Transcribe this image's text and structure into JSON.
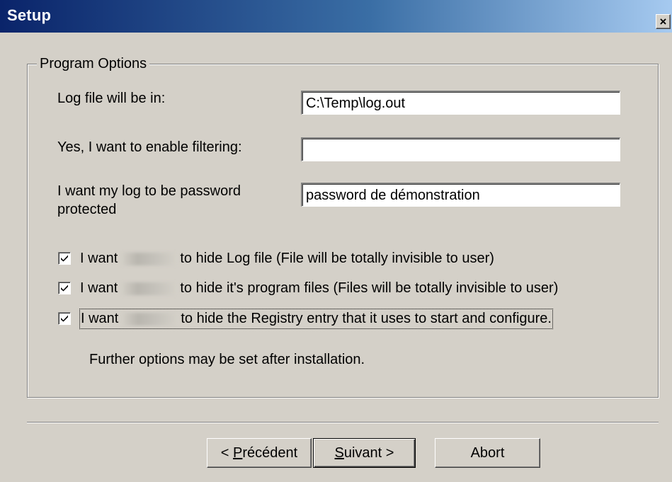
{
  "window": {
    "title": "Setup",
    "close_glyph": "×"
  },
  "group": {
    "legend": "Program Options"
  },
  "fields": {
    "log_label": "Log file will be in:",
    "log_value": "C:\\Temp\\log.out",
    "filter_label": "Yes, I want to enable filtering:",
    "filter_value": "",
    "password_label_1": "I want my log to be password",
    "password_label_2": "protected",
    "password_value": "password de démonstration"
  },
  "checkboxes": [
    {
      "prefix": "I want",
      "suffix": "to hide Log file (File will be totally invisible to user)",
      "checked": true
    },
    {
      "prefix": "I want",
      "suffix": "to hide it's program files (Files will be totally invisible to user)",
      "checked": true
    },
    {
      "prefix": "I want",
      "suffix": "to hide the Registry entry that it uses to start and configure.",
      "checked": true
    }
  ],
  "note": "Further options may be set after installation.",
  "buttons": {
    "back_prefix": "< ",
    "back_access": "P",
    "back_rest": "récédent",
    "next_access": "S",
    "next_rest": "uivant >",
    "abort": "Abort"
  },
  "icons": {
    "close": "close-icon",
    "checkmark": "checkmark-icon"
  }
}
